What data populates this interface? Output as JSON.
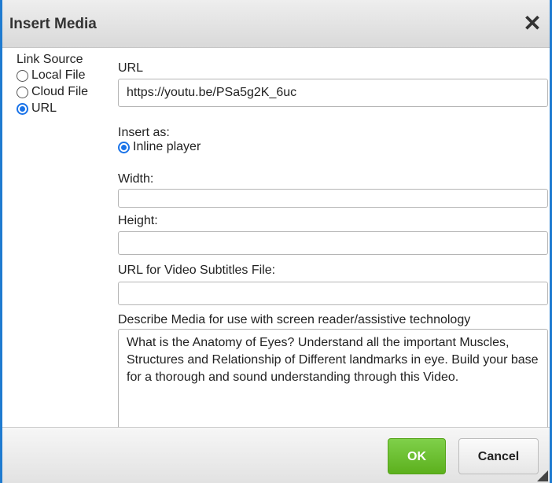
{
  "dialog": {
    "title": "Insert Media",
    "close_glyph": "✕"
  },
  "link_source": {
    "legend": "Link Source",
    "options": [
      {
        "label": "Local File",
        "checked": false
      },
      {
        "label": "Cloud File",
        "checked": false
      },
      {
        "label": "URL",
        "checked": true
      }
    ]
  },
  "form": {
    "url_label": "URL",
    "url_value": "https://youtu.be/PSa5g2K_6uc",
    "insert_as_label": "Insert as:",
    "insert_as_option": "Inline player",
    "width_label": "Width:",
    "width_value": "",
    "height_label": "Height:",
    "height_value": "",
    "subtitles_label": "URL for Video Subtitles File:",
    "subtitles_value": "",
    "describe_label": "Describe Media for use with screen reader/assistive technology",
    "describe_value": "What is the Anatomy of Eyes? Understand all the important Muscles, Structures and Relationship of Different landmarks in eye. Build your base for a thorough and sound understanding through this Video."
  },
  "footer": {
    "ok_label": "OK",
    "cancel_label": "Cancel"
  },
  "colors": {
    "accent": "#1a73e8",
    "ok_green": "#5cb01d",
    "frame_blue": "#1f7bd0"
  }
}
